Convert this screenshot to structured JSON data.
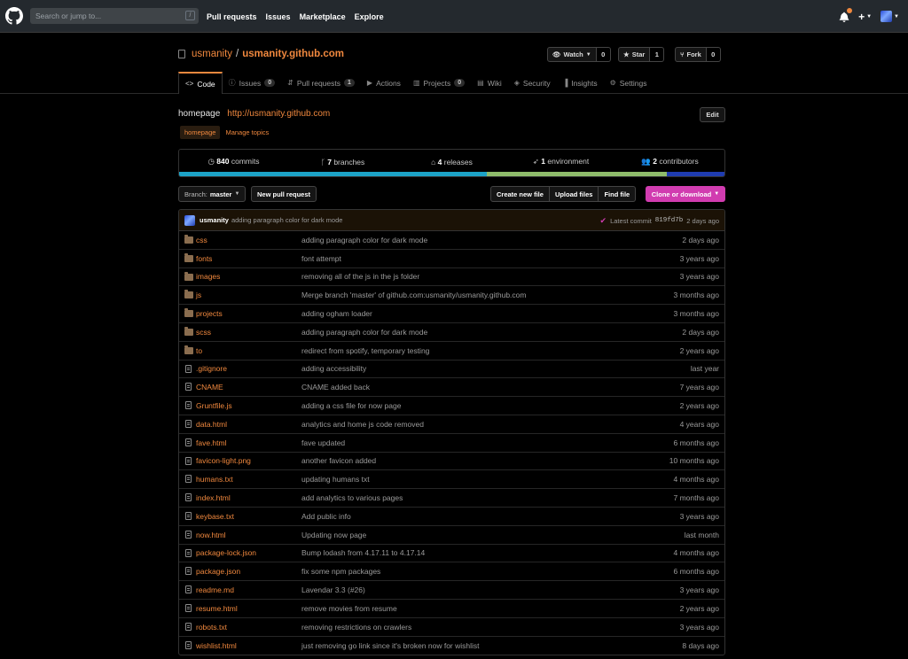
{
  "header": {
    "search_placeholder": "Search or jump to...",
    "search_hint": "/",
    "nav": [
      "Pull requests",
      "Issues",
      "Marketplace",
      "Explore"
    ],
    "plus_label": "+"
  },
  "repo": {
    "owner": "usmanity",
    "separator": "/",
    "name": "usmanity.github.com",
    "watch_label": "Watch",
    "watch_count": "0",
    "star_label": "Star",
    "star_count": "1",
    "fork_label": "Fork",
    "fork_count": "0"
  },
  "tabs": [
    {
      "label": "Code",
      "icon": "code-icon",
      "glyph": "<>",
      "count": ""
    },
    {
      "label": "Issues",
      "icon": "issue-icon",
      "glyph": "ⓘ",
      "count": "0"
    },
    {
      "label": "Pull requests",
      "icon": "pull-request-icon",
      "glyph": "⇵",
      "count": "1"
    },
    {
      "label": "Actions",
      "icon": "play-icon",
      "glyph": "▶",
      "count": ""
    },
    {
      "label": "Projects",
      "icon": "project-icon",
      "glyph": "▥",
      "count": "0"
    },
    {
      "label": "Wiki",
      "icon": "book-icon",
      "glyph": "▤",
      "count": ""
    },
    {
      "label": "Security",
      "icon": "shield-icon",
      "glyph": "◈",
      "count": ""
    },
    {
      "label": "Insights",
      "icon": "graph-icon",
      "glyph": "▐",
      "count": ""
    },
    {
      "label": "Settings",
      "icon": "gear-icon",
      "glyph": "⚙",
      "count": ""
    }
  ],
  "about": {
    "description": "homepage",
    "website": "http://usmanity.github.com",
    "edit_label": "Edit",
    "topic": "homepage",
    "manage_topics": "Manage topics"
  },
  "summary": {
    "commits_count": "840",
    "commits_label": "commits",
    "branches_count": "7",
    "branches_label": "branches",
    "releases_count": "4",
    "releases_label": "releases",
    "environment_count": "1",
    "environment_label": "environment",
    "contributors_count": "2",
    "contributors_label": "contributors"
  },
  "language_bar": [
    {
      "share": 0.565,
      "color": "#1ca3c7"
    },
    {
      "share": 0.33,
      "color": "#8fbc6b"
    },
    {
      "share": 0.105,
      "color": "#1f3cb0"
    }
  ],
  "filenav": {
    "branch_prefix": "Branch:",
    "branch_name": "master",
    "new_pr": "New pull request",
    "create_file": "Create new file",
    "upload_files": "Upload files",
    "find_file": "Find file",
    "clone": "Clone or download"
  },
  "latest_commit": {
    "author": "usmanity",
    "message": "adding paragraph color for dark mode",
    "label": "Latest commit",
    "sha": "819fd7b",
    "age": "2 days ago"
  },
  "files": [
    {
      "type": "folder",
      "name": "css",
      "message": "adding paragraph color for dark mode",
      "age": "2 days ago"
    },
    {
      "type": "folder",
      "name": "fonts",
      "message": "font attempt",
      "age": "3 years ago"
    },
    {
      "type": "folder",
      "name": "images",
      "message": "removing all of the js in the js folder",
      "age": "3 years ago"
    },
    {
      "type": "folder",
      "name": "js",
      "message": "Merge branch 'master' of github.com:usmanity/usmanity.github.com",
      "age": "3 months ago"
    },
    {
      "type": "folder",
      "name": "projects",
      "message": "adding ogham loader",
      "age": "3 months ago"
    },
    {
      "type": "folder",
      "name": "scss",
      "message": "adding paragraph color for dark mode",
      "age": "2 days ago"
    },
    {
      "type": "folder",
      "name": "to",
      "message": "redirect from spotify, temporary testing",
      "age": "2 years ago"
    },
    {
      "type": "file",
      "name": ".gitignore",
      "message": "adding accessibility",
      "age": "last year"
    },
    {
      "type": "file",
      "name": "CNAME",
      "message": "CNAME added back",
      "age": "7 years ago"
    },
    {
      "type": "file",
      "name": "Gruntfile.js",
      "message": "adding a css file for now page",
      "age": "2 years ago"
    },
    {
      "type": "file",
      "name": "data.html",
      "message": "analytics and home js code removed",
      "age": "4 years ago"
    },
    {
      "type": "file",
      "name": "fave.html",
      "message": "fave updated",
      "age": "6 months ago"
    },
    {
      "type": "file",
      "name": "favicon-light.png",
      "message": "another favicon added",
      "age": "10 months ago"
    },
    {
      "type": "file",
      "name": "humans.txt",
      "message": "updating humans txt",
      "age": "4 months ago"
    },
    {
      "type": "file",
      "name": "index.html",
      "message": "add analytics to various pages",
      "age": "7 months ago"
    },
    {
      "type": "file",
      "name": "keybase.txt",
      "message": "Add public info",
      "age": "3 years ago"
    },
    {
      "type": "file",
      "name": "now.html",
      "message": "Updating now page",
      "age": "last month"
    },
    {
      "type": "file",
      "name": "package-lock.json",
      "message": "Bump lodash from 4.17.11 to 4.17.14",
      "age": "4 months ago"
    },
    {
      "type": "file",
      "name": "package.json",
      "message": "fix some npm packages",
      "age": "6 months ago"
    },
    {
      "type": "file",
      "name": "readme.md",
      "message": "Lavendar 3.3 (#26)",
      "age": "3 years ago"
    },
    {
      "type": "file",
      "name": "resume.html",
      "message": "remove movies from resume",
      "age": "2 years ago"
    },
    {
      "type": "file",
      "name": "robots.txt",
      "message": "removing restrictions on crawlers",
      "age": "3 years ago"
    },
    {
      "type": "file",
      "name": "wishlist.html",
      "message": "just removing go link since it's broken now for wishlist",
      "age": "8 days ago"
    }
  ]
}
